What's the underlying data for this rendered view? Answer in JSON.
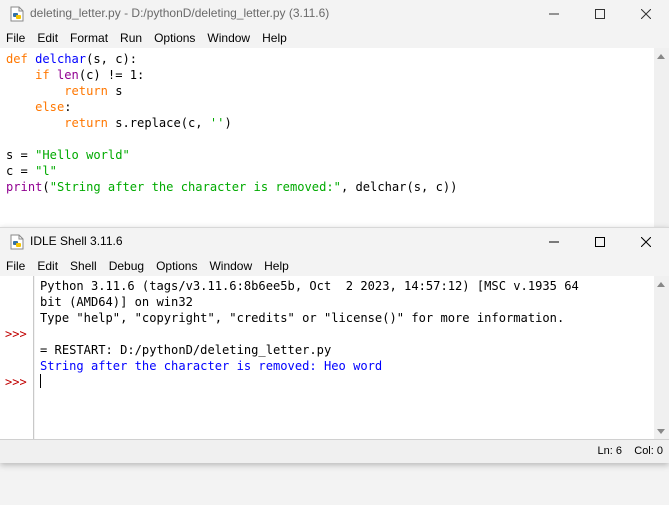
{
  "editor": {
    "title": "deleting_letter.py - D:/pythonD/deleting_letter.py (3.11.6)",
    "menu": [
      "File",
      "Edit",
      "Format",
      "Run",
      "Options",
      "Window",
      "Help"
    ]
  },
  "code": {
    "l1_def": "def",
    "l1_name": "delchar",
    "l1_rest": "(s, c):",
    "l2_if": "if",
    "l2_len": "len",
    "l2_rest": "(c) != 1:",
    "l3_return": "return",
    "l3_rest": " s",
    "l4_else": "else",
    "l4_rest": ":",
    "l5_return": "return",
    "l5_rest": " s.replace(c, ",
    "l5_str": "''",
    "l5_end": ")",
    "l7_a": "s = ",
    "l7_str": "\"Hello world\"",
    "l8_a": "c = ",
    "l8_str": "\"l\"",
    "l9_print": "print",
    "l9_open": "(",
    "l9_str": "\"String after the character is removed:\"",
    "l9_rest": ", delchar(s, c))"
  },
  "shell": {
    "title": "IDLE Shell 3.11.6",
    "menu": [
      "File",
      "Edit",
      "Shell",
      "Debug",
      "Options",
      "Window",
      "Help"
    ],
    "banner_1": "Python 3.11.6 (tags/v3.11.6:8b6ee5b, Oct  2 2023, 14:57:12) [MSC v.1935 64",
    "banner_2": "bit (AMD64)] on win32",
    "banner_3": "Type \"help\", \"copyright\", \"credits\" or \"license()\" for more information.",
    "restart": "= RESTART: D:/pythonD/deleting_letter.py",
    "output": "String after the character is removed: Heo word",
    "prompt": ">>>",
    "status_ln": "Ln: 6",
    "status_col": "Col: 0"
  },
  "colors": {
    "keyword": "#ff7700",
    "builtin": "#900090",
    "definition": "#0000ff",
    "string": "#00aa00",
    "prompt": "#c00000",
    "stdout": "#0000ff"
  }
}
